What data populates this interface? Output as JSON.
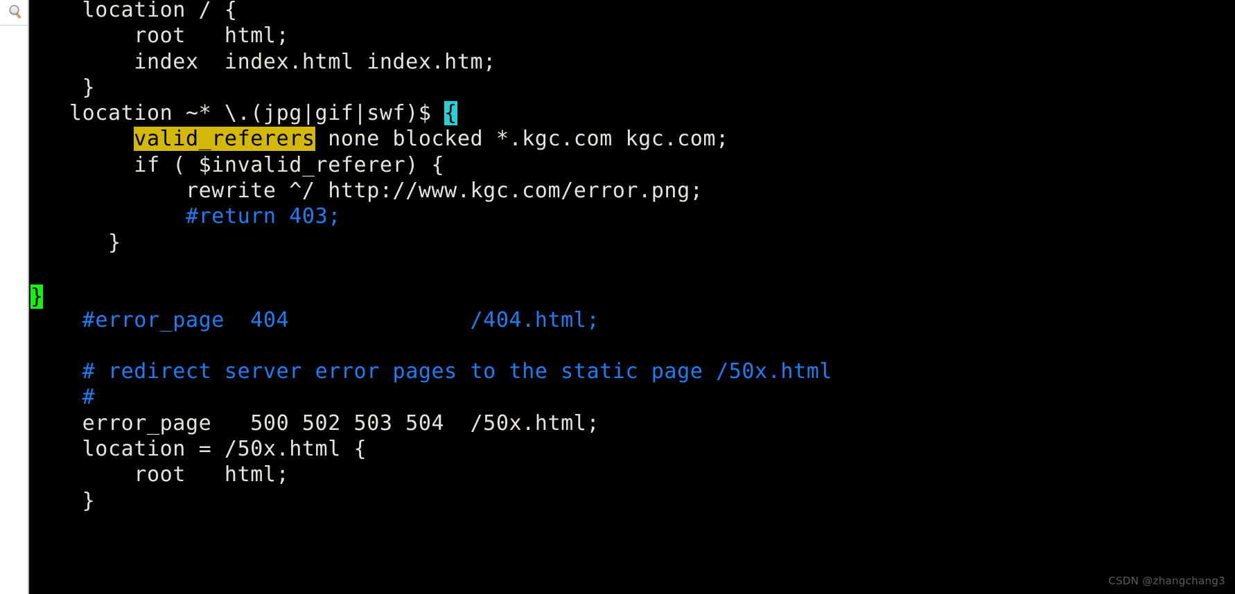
{
  "window": {
    "background_color": "#000000",
    "foreground_color": "#e8e4dc",
    "comment_color": "#1a7ff5",
    "search_highlight_color": "#d4b807",
    "match_highlight_color": "#22d3d8",
    "cursor_color": "#12f312"
  },
  "left_panel": {
    "search_icon_name": "search-icon",
    "search_icon_tooltip": "Search"
  },
  "editor": {
    "file_type": "nginx configuration",
    "cursor_char": "}",
    "search_term": "valid_referers",
    "lines": [
      {
        "id": 1,
        "text": "    location / {",
        "segments": [
          {
            "text": "    location / {",
            "style": "plain"
          }
        ]
      },
      {
        "id": 2,
        "text": "        root   html;",
        "segments": [
          {
            "text": "        root   html;",
            "style": "plain"
          }
        ]
      },
      {
        "id": 3,
        "text": "        index  index.html index.htm;",
        "segments": [
          {
            "text": "        index  index.html index.htm;",
            "style": "plain"
          }
        ]
      },
      {
        "id": 4,
        "text": "    }",
        "segments": [
          {
            "text": "    }",
            "style": "plain"
          }
        ]
      },
      {
        "id": 5,
        "text": "   location ~* \\.(jpg|gif|swf)$ {",
        "segments": [
          {
            "text": "   location ~* \\.(jpg|gif|swf)$ ",
            "style": "plain"
          },
          {
            "text": "{",
            "style": "match"
          }
        ]
      },
      {
        "id": 6,
        "text": "        valid_referers none blocked *.kgc.com kgc.com;",
        "segments": [
          {
            "text": "        ",
            "style": "plain"
          },
          {
            "text": "valid_referers",
            "style": "search"
          },
          {
            "text": " none blocked *.kgc.com kgc.com;",
            "style": "plain"
          }
        ]
      },
      {
        "id": 7,
        "text": "        if ( $invalid_referer) {",
        "segments": [
          {
            "text": "        if ( $invalid_referer) {",
            "style": "plain"
          }
        ]
      },
      {
        "id": 8,
        "text": "            rewrite ^/ http://www.kgc.com/error.png;",
        "segments": [
          {
            "text": "            rewrite ^/ http://www.kgc.com/error.png;",
            "style": "plain"
          }
        ]
      },
      {
        "id": 9,
        "text": "            #return 403;",
        "segments": [
          {
            "text": "            ",
            "style": "plain"
          },
          {
            "text": "#return 403;",
            "style": "comment"
          }
        ]
      },
      {
        "id": 10,
        "text": "      }",
        "segments": [
          {
            "text": "      }",
            "style": "plain"
          }
        ]
      },
      {
        "id": 11,
        "text": "",
        "segments": []
      },
      {
        "id": 12,
        "text": "",
        "segments": []
      },
      {
        "id": 13,
        "text": "    #error_page  404              /404.html;",
        "segments": [
          {
            "text": "    ",
            "style": "plain"
          },
          {
            "text": "#error_page  404              /404.html;",
            "style": "comment"
          }
        ]
      },
      {
        "id": 14,
        "text": "",
        "segments": []
      },
      {
        "id": 15,
        "text": "    # redirect server error pages to the static page /50x.html",
        "segments": [
          {
            "text": "    ",
            "style": "plain"
          },
          {
            "text": "# redirect server error pages to the static page /50x.html",
            "style": "comment"
          }
        ]
      },
      {
        "id": 16,
        "text": "    #",
        "segments": [
          {
            "text": "    ",
            "style": "plain"
          },
          {
            "text": "#",
            "style": "comment"
          }
        ]
      },
      {
        "id": 17,
        "text": "    error_page   500 502 503 504  /50x.html;",
        "segments": [
          {
            "text": "    error_page   500 502 503 504  /50x.html;",
            "style": "plain"
          }
        ]
      },
      {
        "id": 18,
        "text": "    location = /50x.html {",
        "segments": [
          {
            "text": "    location = /50x.html {",
            "style": "plain"
          }
        ]
      },
      {
        "id": 19,
        "text": "        root   html;",
        "segments": [
          {
            "text": "        root   html;",
            "style": "plain"
          }
        ]
      },
      {
        "id": 20,
        "text": "    }",
        "segments": [
          {
            "text": "    }",
            "style": "plain"
          }
        ]
      }
    ]
  },
  "watermark": {
    "text": "CSDN @zhangchang3"
  }
}
